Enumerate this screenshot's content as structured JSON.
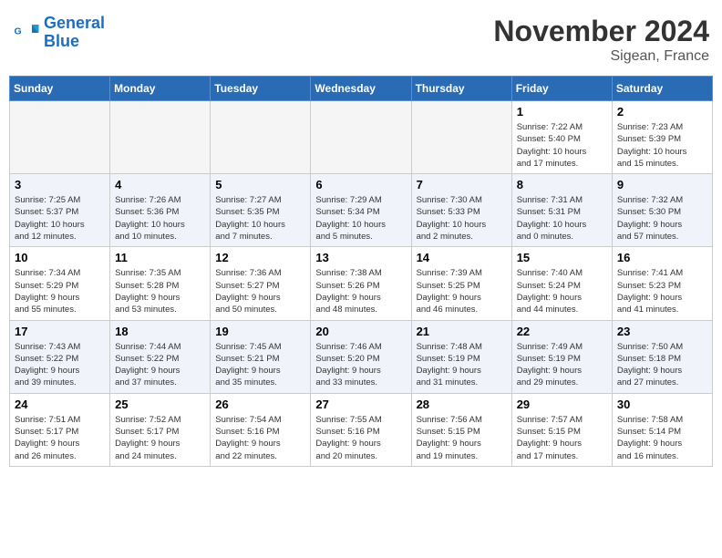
{
  "logo": {
    "line1": "General",
    "line2": "Blue"
  },
  "title": "November 2024",
  "location": "Sigean, France",
  "weekdays": [
    "Sunday",
    "Monday",
    "Tuesday",
    "Wednesday",
    "Thursday",
    "Friday",
    "Saturday"
  ],
  "weeks": [
    [
      {
        "day": "",
        "info": ""
      },
      {
        "day": "",
        "info": ""
      },
      {
        "day": "",
        "info": ""
      },
      {
        "day": "",
        "info": ""
      },
      {
        "day": "",
        "info": ""
      },
      {
        "day": "1",
        "info": "Sunrise: 7:22 AM\nSunset: 5:40 PM\nDaylight: 10 hours\nand 17 minutes."
      },
      {
        "day": "2",
        "info": "Sunrise: 7:23 AM\nSunset: 5:39 PM\nDaylight: 10 hours\nand 15 minutes."
      }
    ],
    [
      {
        "day": "3",
        "info": "Sunrise: 7:25 AM\nSunset: 5:37 PM\nDaylight: 10 hours\nand 12 minutes."
      },
      {
        "day": "4",
        "info": "Sunrise: 7:26 AM\nSunset: 5:36 PM\nDaylight: 10 hours\nand 10 minutes."
      },
      {
        "day": "5",
        "info": "Sunrise: 7:27 AM\nSunset: 5:35 PM\nDaylight: 10 hours\nand 7 minutes."
      },
      {
        "day": "6",
        "info": "Sunrise: 7:29 AM\nSunset: 5:34 PM\nDaylight: 10 hours\nand 5 minutes."
      },
      {
        "day": "7",
        "info": "Sunrise: 7:30 AM\nSunset: 5:33 PM\nDaylight: 10 hours\nand 2 minutes."
      },
      {
        "day": "8",
        "info": "Sunrise: 7:31 AM\nSunset: 5:31 PM\nDaylight: 10 hours\nand 0 minutes."
      },
      {
        "day": "9",
        "info": "Sunrise: 7:32 AM\nSunset: 5:30 PM\nDaylight: 9 hours\nand 57 minutes."
      }
    ],
    [
      {
        "day": "10",
        "info": "Sunrise: 7:34 AM\nSunset: 5:29 PM\nDaylight: 9 hours\nand 55 minutes."
      },
      {
        "day": "11",
        "info": "Sunrise: 7:35 AM\nSunset: 5:28 PM\nDaylight: 9 hours\nand 53 minutes."
      },
      {
        "day": "12",
        "info": "Sunrise: 7:36 AM\nSunset: 5:27 PM\nDaylight: 9 hours\nand 50 minutes."
      },
      {
        "day": "13",
        "info": "Sunrise: 7:38 AM\nSunset: 5:26 PM\nDaylight: 9 hours\nand 48 minutes."
      },
      {
        "day": "14",
        "info": "Sunrise: 7:39 AM\nSunset: 5:25 PM\nDaylight: 9 hours\nand 46 minutes."
      },
      {
        "day": "15",
        "info": "Sunrise: 7:40 AM\nSunset: 5:24 PM\nDaylight: 9 hours\nand 44 minutes."
      },
      {
        "day": "16",
        "info": "Sunrise: 7:41 AM\nSunset: 5:23 PM\nDaylight: 9 hours\nand 41 minutes."
      }
    ],
    [
      {
        "day": "17",
        "info": "Sunrise: 7:43 AM\nSunset: 5:22 PM\nDaylight: 9 hours\nand 39 minutes."
      },
      {
        "day": "18",
        "info": "Sunrise: 7:44 AM\nSunset: 5:22 PM\nDaylight: 9 hours\nand 37 minutes."
      },
      {
        "day": "19",
        "info": "Sunrise: 7:45 AM\nSunset: 5:21 PM\nDaylight: 9 hours\nand 35 minutes."
      },
      {
        "day": "20",
        "info": "Sunrise: 7:46 AM\nSunset: 5:20 PM\nDaylight: 9 hours\nand 33 minutes."
      },
      {
        "day": "21",
        "info": "Sunrise: 7:48 AM\nSunset: 5:19 PM\nDaylight: 9 hours\nand 31 minutes."
      },
      {
        "day": "22",
        "info": "Sunrise: 7:49 AM\nSunset: 5:19 PM\nDaylight: 9 hours\nand 29 minutes."
      },
      {
        "day": "23",
        "info": "Sunrise: 7:50 AM\nSunset: 5:18 PM\nDaylight: 9 hours\nand 27 minutes."
      }
    ],
    [
      {
        "day": "24",
        "info": "Sunrise: 7:51 AM\nSunset: 5:17 PM\nDaylight: 9 hours\nand 26 minutes."
      },
      {
        "day": "25",
        "info": "Sunrise: 7:52 AM\nSunset: 5:17 PM\nDaylight: 9 hours\nand 24 minutes."
      },
      {
        "day": "26",
        "info": "Sunrise: 7:54 AM\nSunset: 5:16 PM\nDaylight: 9 hours\nand 22 minutes."
      },
      {
        "day": "27",
        "info": "Sunrise: 7:55 AM\nSunset: 5:16 PM\nDaylight: 9 hours\nand 20 minutes."
      },
      {
        "day": "28",
        "info": "Sunrise: 7:56 AM\nSunset: 5:15 PM\nDaylight: 9 hours\nand 19 minutes."
      },
      {
        "day": "29",
        "info": "Sunrise: 7:57 AM\nSunset: 5:15 PM\nDaylight: 9 hours\nand 17 minutes."
      },
      {
        "day": "30",
        "info": "Sunrise: 7:58 AM\nSunset: 5:14 PM\nDaylight: 9 hours\nand 16 minutes."
      }
    ]
  ]
}
